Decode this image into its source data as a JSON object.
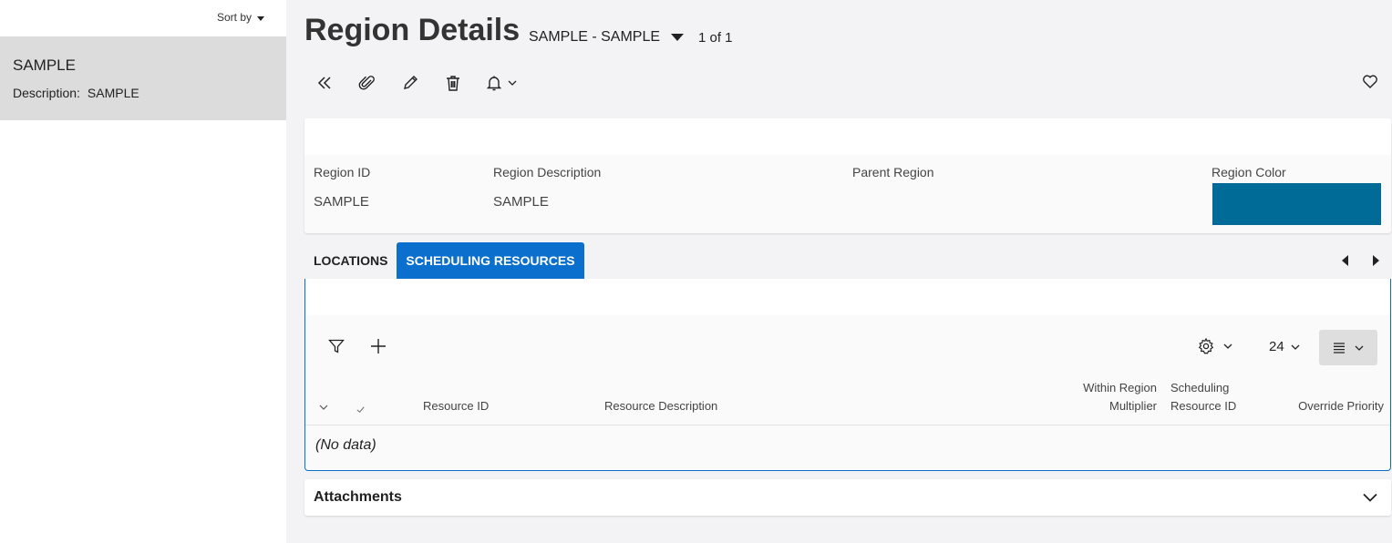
{
  "sidebar": {
    "sort_label": "Sort by",
    "items": [
      {
        "title": "SAMPLE",
        "desc_label": "Description:",
        "desc_value": "SAMPLE"
      }
    ]
  },
  "header": {
    "title": "Region Details",
    "record": "SAMPLE - SAMPLE",
    "pager": "1 of 1"
  },
  "toolbar": {
    "icons": [
      "double-chevron-left-icon",
      "paperclip-icon",
      "pencil-icon",
      "trash-icon",
      "bell-icon",
      "heart-icon"
    ]
  },
  "record_card": {
    "fields": [
      {
        "label": "Region ID",
        "value": "SAMPLE"
      },
      {
        "label": "Region Description",
        "value": "SAMPLE"
      },
      {
        "label": "Parent Region",
        "value": ""
      },
      {
        "label": "Region Color",
        "value": ""
      }
    ],
    "region_color": "#006b96"
  },
  "tabs": [
    {
      "label": "LOCATIONS",
      "active": false
    },
    {
      "label": "SCHEDULING RESOURCES",
      "active": true
    }
  ],
  "grid": {
    "page_size": "24",
    "columns": [
      {
        "line1": "Resource ID",
        "line2": ""
      },
      {
        "line1": "Resource Description",
        "line2": ""
      },
      {
        "line1": "Within Region",
        "line2": "Multiplier"
      },
      {
        "line1": "Scheduling",
        "line2": "Resource ID"
      },
      {
        "line1": "Override Priority",
        "line2": ""
      }
    ],
    "empty_text": "(No data)"
  },
  "attachments": {
    "label": "Attachments"
  },
  "colors": {
    "accent": "#0a6fcd",
    "selected_row": "#dcdcdc",
    "background": "#f3f2f4"
  }
}
